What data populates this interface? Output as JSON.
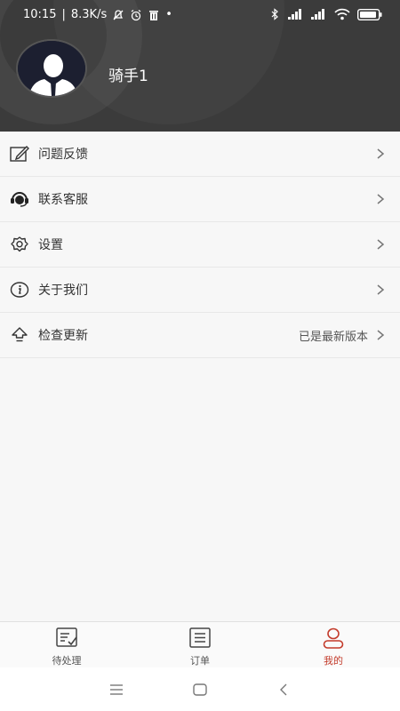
{
  "status_bar": {
    "time": "10:15",
    "speed": "8.3K/s",
    "separator": "|",
    "dot": "•"
  },
  "profile": {
    "username": "骑手1"
  },
  "menu": {
    "items": [
      {
        "label": "问题反馈",
        "value": "",
        "icon": "edit-icon"
      },
      {
        "label": "联系客服",
        "value": "",
        "icon": "headset-icon"
      },
      {
        "label": "设置",
        "value": "",
        "icon": "gear-icon"
      },
      {
        "label": "关于我们",
        "value": "",
        "icon": "info-icon"
      },
      {
        "label": "检查更新",
        "value": "已是最新版本",
        "icon": "upload-arrow-icon"
      }
    ]
  },
  "tabbar": {
    "tabs": [
      {
        "label": "待处理",
        "icon": "pending-list-icon",
        "active": false
      },
      {
        "label": "订单",
        "icon": "order-list-icon",
        "active": false
      },
      {
        "label": "我的",
        "icon": "person-icon",
        "active": true
      }
    ]
  },
  "colors": {
    "header_bg": "#3b3b3b",
    "active_tab": "#c33b2b",
    "page_bg": "#f7f7f7"
  }
}
